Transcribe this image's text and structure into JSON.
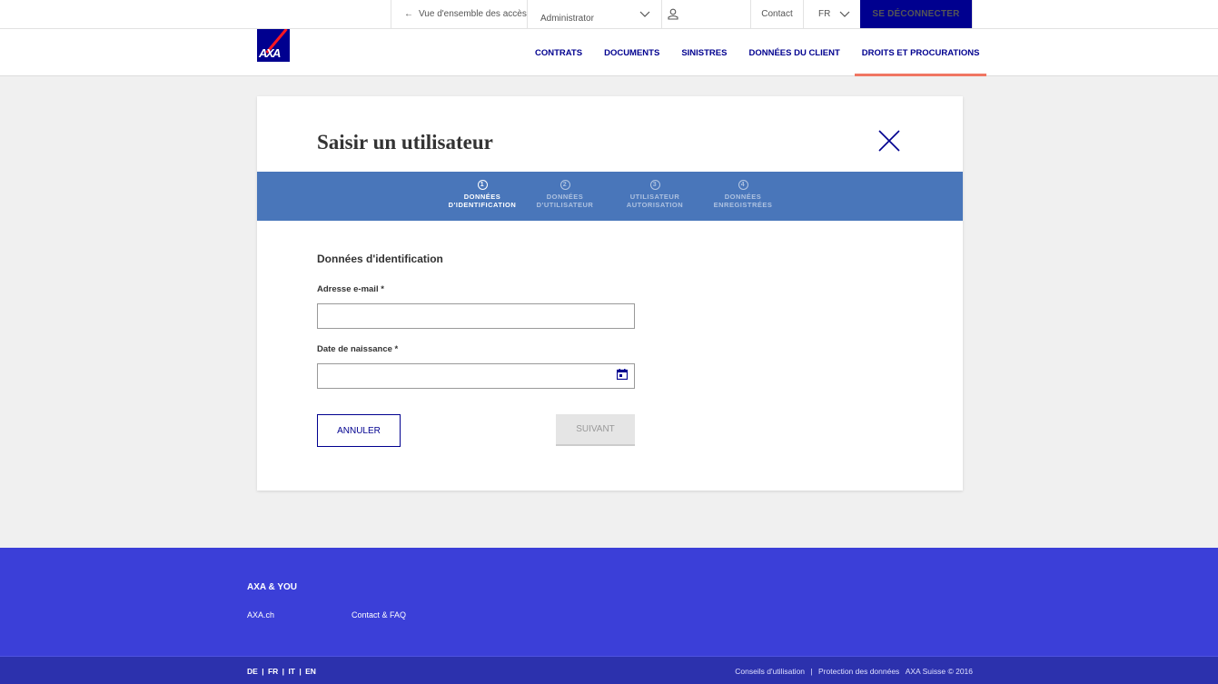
{
  "topbar": {
    "back_label": "Vue d'ensemble des accès",
    "role_value": "Administrator",
    "contact_label": "Contact",
    "language_value": "FR",
    "logout_label": "SE DÉCONNECTER"
  },
  "logo": {
    "text": "AXA"
  },
  "nav": {
    "items": [
      {
        "label": "CONTRATS"
      },
      {
        "label": "DOCUMENTS"
      },
      {
        "label": "SINISTRES"
      },
      {
        "label": "DONNÉES DU CLIENT"
      },
      {
        "label": "DROITS ET PROCURATIONS"
      }
    ],
    "active_index": 4
  },
  "dialog": {
    "title": "Saisir un utilisateur",
    "steps": [
      {
        "num": "1",
        "line1": "DONNÉES",
        "line2": "D'IDENTIFICATION"
      },
      {
        "num": "2",
        "line1": "DONNÉES",
        "line2": "D'UTILISATEUR"
      },
      {
        "num": "3",
        "line1": "UTILISATEUR",
        "line2": "AUTORISATION"
      },
      {
        "num": "4",
        "line1": "DONNÉES",
        "line2": "ENREGISTRÉES"
      }
    ],
    "section_title": "Données d'identification",
    "email_label": "Adresse e-mail *",
    "email_value": "",
    "birthdate_label": "Date de naissance *",
    "birthdate_value": "",
    "cancel_label": "ANNULER",
    "next_label": "SUIVANT"
  },
  "footer": {
    "title": "AXA & YOU",
    "links": [
      "AXA.ch",
      "Contact & FAQ"
    ],
    "languages": [
      "DE",
      "FR",
      "IT",
      "EN"
    ],
    "language_separator": "|",
    "legal": [
      "Conseils d'utilisation",
      "|",
      "Protection des données",
      "AXA Suisse © 2016"
    ]
  },
  "colors": {
    "brand_blue": "#00008f",
    "stepper_blue": "#4976ba",
    "footer_blue": "#3b3fd8",
    "active_underline": "#f07662"
  },
  "icons": {
    "back": "arrow-left-icon",
    "role_dropdown": "chevron-down-icon",
    "user": "user-icon",
    "language_dropdown": "chevron-down-icon",
    "close": "close-icon",
    "calendar": "calendar-icon"
  }
}
